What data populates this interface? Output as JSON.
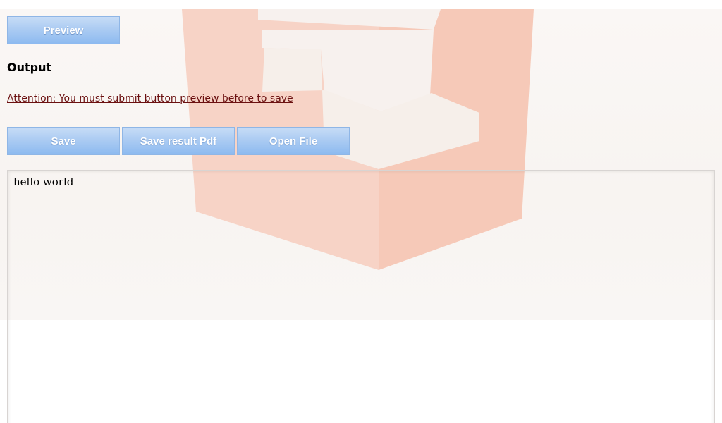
{
  "toolbar": {
    "preview_label": "Preview",
    "save_label": "Save",
    "save_pdf_label": "Save result Pdf",
    "open_file_label": "Open File"
  },
  "output": {
    "heading": "Output",
    "attention_text": "Attention: You must submit button preview before to save",
    "content": "hello world"
  },
  "icons": {
    "background_logo": "html5-shield-icon"
  },
  "colors": {
    "button_gradient_top": "#c7dcf6",
    "button_gradient_bottom": "#8dbaf0",
    "attention_text": "#6b1010",
    "logo_tint": "#f7d1c2"
  }
}
